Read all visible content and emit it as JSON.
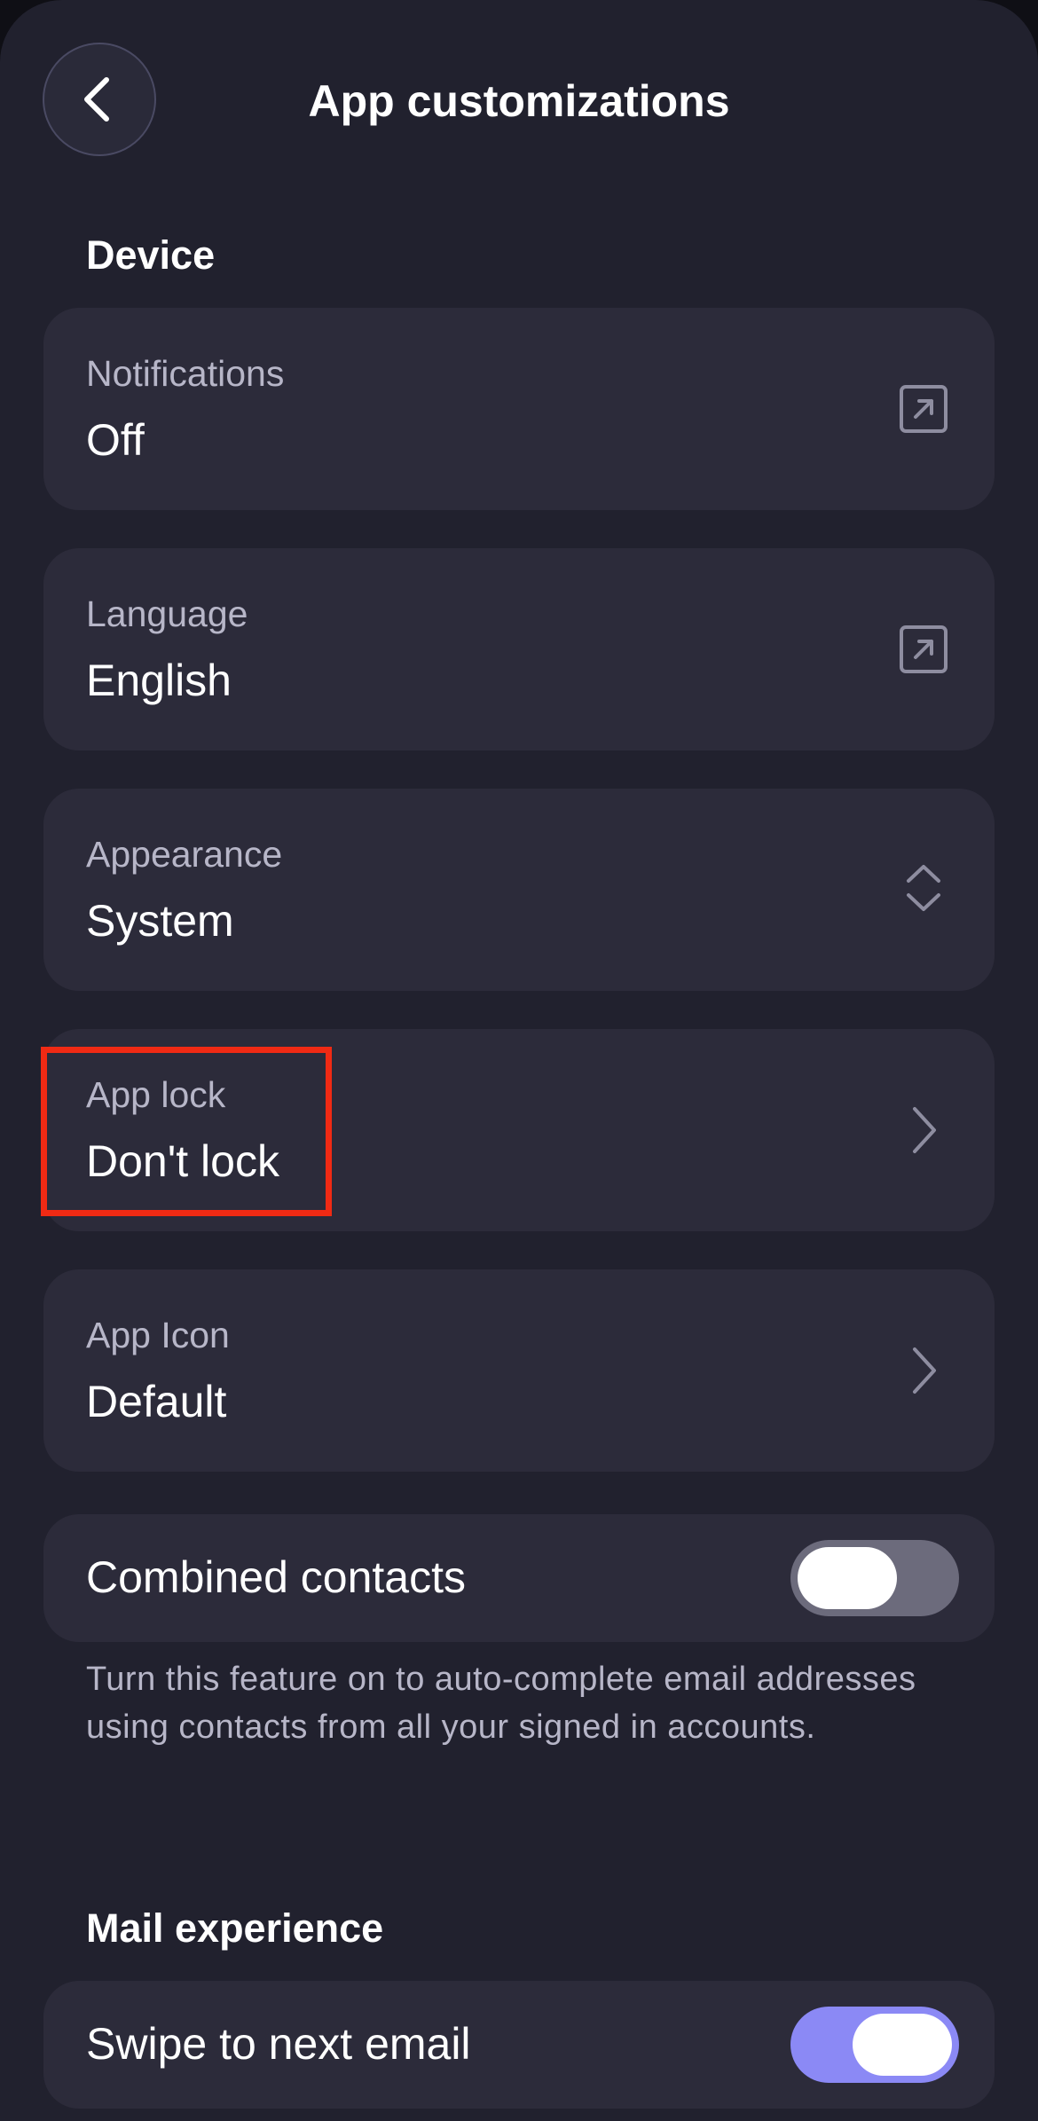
{
  "header": {
    "title": "App customizations",
    "back_icon": "chevron-left-icon"
  },
  "device_section": {
    "title": "Device",
    "notifications": {
      "label": "Notifications",
      "value": "Off",
      "icon": "external-link-icon"
    },
    "language": {
      "label": "Language",
      "value": "English",
      "icon": "external-link-icon"
    },
    "appearance": {
      "label": "Appearance",
      "value": "System",
      "icon": "chevron-up-down-icon"
    },
    "app_lock": {
      "label": "App lock",
      "value": "Don't lock",
      "icon": "chevron-right-icon"
    },
    "app_icon": {
      "label": "App Icon",
      "value": "Default",
      "icon": "chevron-right-icon"
    },
    "combined_contacts": {
      "label": "Combined contacts",
      "enabled": false,
      "helper": "Turn this feature on to auto-complete email addresses using contacts from all your signed in accounts."
    }
  },
  "mail_section": {
    "title": "Mail experience",
    "swipe_next": {
      "label": "Swipe to next email",
      "enabled": true
    }
  },
  "colors": {
    "background": "#21212e",
    "card": "#2c2b3a",
    "toggle_off": "#6c6b7c",
    "toggle_on": "#8b89f5",
    "highlight": "#f02a14"
  }
}
